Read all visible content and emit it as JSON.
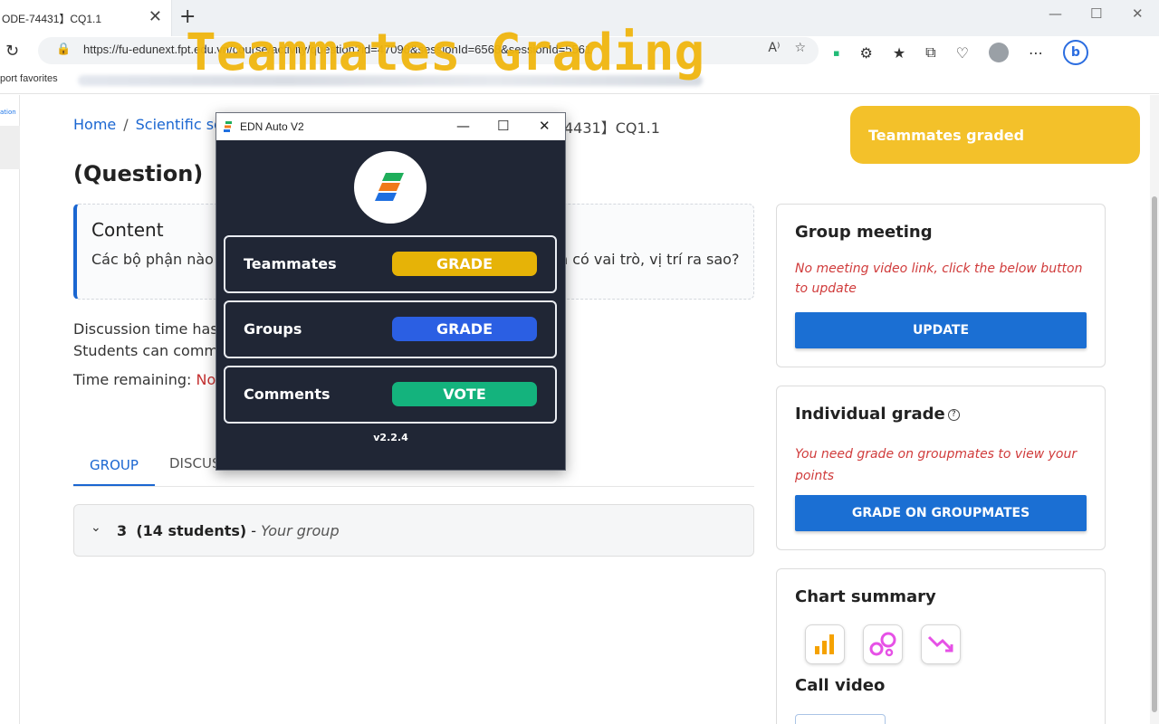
{
  "browser": {
    "tab_title": "ODE-74431】CQ1.1",
    "tab_close": "✕",
    "new_tab": "+",
    "url": "https://fu-edunext.fpt.edu.vn/course/activity/question?id=47098&sessionId=6568&sessionId=5561",
    "favorites_label": "port favorites"
  },
  "overlay": {
    "title": "Teammates Grading"
  },
  "breadcrumb": {
    "home": "Home",
    "separator": "/",
    "course": "Scientific so",
    "end": "4431】CQ1.1"
  },
  "page": {
    "title": "(Question)【",
    "content_title": "Content",
    "content_text_left": "Các bộ phận nào",
    "content_text_right": "n có vai trò, vị trí ra sao?",
    "discussion_line1": "Discussion time has",
    "discussion_line2": "Students can comme",
    "time_remaining_label": "Time remaining:",
    "time_remaining_value": "No",
    "tabs": {
      "group": "GROUP",
      "discuss": "DISCUS"
    },
    "group_row": {
      "number": "3",
      "count": "(14 students)",
      "dash": "-",
      "yours": "Your group"
    }
  },
  "toast": {
    "text": "Teammates graded",
    "color": "#f3c12a"
  },
  "cards": {
    "group_meeting": {
      "title": "Group meeting",
      "note": "No meeting video link, click the below button to update",
      "button": "UPDATE"
    },
    "individual_grade": {
      "title": "Individual grade",
      "help": "?",
      "note": "You need grade on groupmates to view your points",
      "button": "GRADE ON GROUPMATES"
    },
    "chart_summary": {
      "title": "Chart summary",
      "icons": [
        "bar-chart-icon",
        "bubble-chart-icon",
        "trend-down-icon"
      ],
      "call_video": "Call video"
    }
  },
  "edn_app": {
    "window_title": "EDN Auto V2",
    "rows": [
      {
        "label": "Teammates",
        "button": "GRADE",
        "color": "#e6b307"
      },
      {
        "label": "Groups",
        "button": "GRADE",
        "color": "#2b5fe3"
      },
      {
        "label": "Comments",
        "button": "VOTE",
        "color": "#14b37d"
      }
    ],
    "version": "v2.2.4"
  },
  "colors": {
    "accent": "#1b6fd3",
    "warning": "#d03b3b",
    "app_bg": "#202635"
  }
}
